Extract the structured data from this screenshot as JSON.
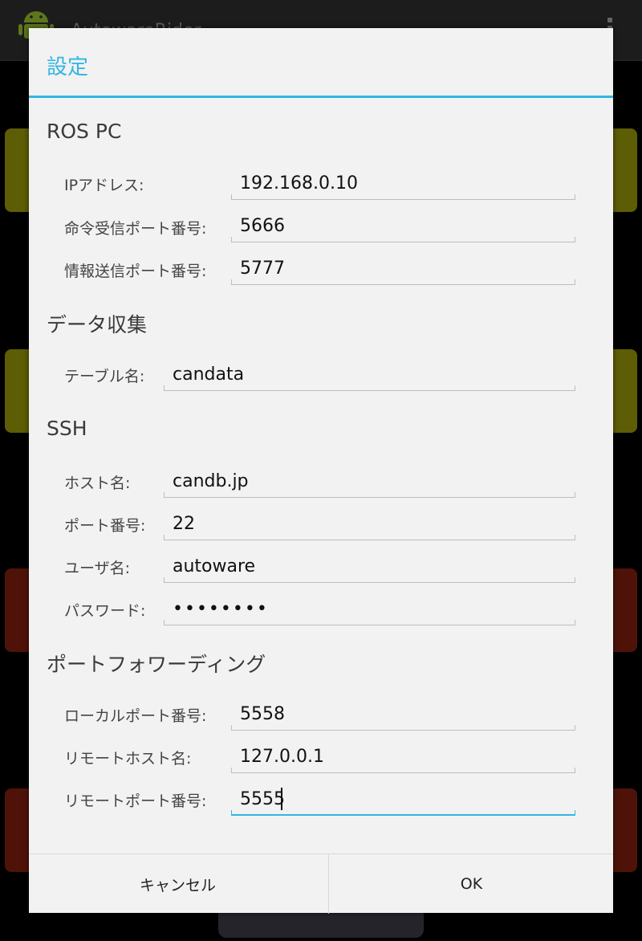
{
  "background_app": {
    "title": "AutowareRider"
  },
  "dialog": {
    "title": "設定",
    "sections": {
      "ros_pc": {
        "title": "ROS PC",
        "ip_label": "IPアドレス:",
        "ip_value": "192.168.0.10",
        "command_port_label": "命令受信ポート番号:",
        "command_port_value": "5666",
        "info_port_label": "情報送信ポート番号:",
        "info_port_value": "5777"
      },
      "data_collection": {
        "title": "データ収集",
        "table_label": "テーブル名:",
        "table_value": "candata"
      },
      "ssh": {
        "title": "SSH",
        "host_label": "ホスト名:",
        "host_value": "candb.jp",
        "port_label": "ポート番号:",
        "port_value": "22",
        "user_label": "ユーザ名:",
        "user_value": "autoware",
        "password_label": "パスワード:",
        "password_value": "••••••••"
      },
      "port_forwarding": {
        "title": "ポートフォワーディング",
        "local_port_label": "ローカルポート番号:",
        "local_port_value": "5558",
        "remote_host_label": "リモートホスト名:",
        "remote_host_value": "127.0.0.1",
        "remote_port_label": "リモートポート番号:",
        "remote_port_value": "5555"
      }
    },
    "buttons": {
      "cancel": "キャンセル",
      "ok": "OK"
    }
  },
  "colors": {
    "accent": "#33b5e5",
    "dialog_bg": "#f2f2f2",
    "bg_yellow": "#8f8f0a",
    "bg_red": "#7a1d0e"
  }
}
